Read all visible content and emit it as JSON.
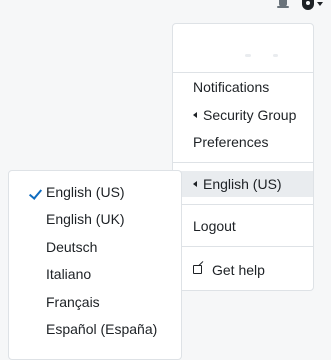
{
  "topbar": {
    "icons": [
      "bell-icon",
      "user-icon",
      "caret-down-icon"
    ]
  },
  "user_menu": {
    "items": [
      {
        "label": "Notifications"
      },
      {
        "label": "Security Group",
        "icon": "chevron-left-icon"
      },
      {
        "label": "Preferences"
      }
    ],
    "language_item": {
      "label": "English (US)",
      "icon": "chevron-left-icon"
    },
    "logout": {
      "label": "Logout"
    },
    "help": {
      "label": "Get help",
      "icon": "external-link-icon"
    }
  },
  "language_submenu": {
    "selected_icon": "check-icon",
    "accent_color": "#0f6cbf",
    "items": [
      {
        "label": "English (US)",
        "selected": true
      },
      {
        "label": "English (UK)"
      },
      {
        "label": "Deutsch"
      },
      {
        "label": "Italiano"
      },
      {
        "label": "Français"
      },
      {
        "label": "Español (España)"
      }
    ]
  }
}
